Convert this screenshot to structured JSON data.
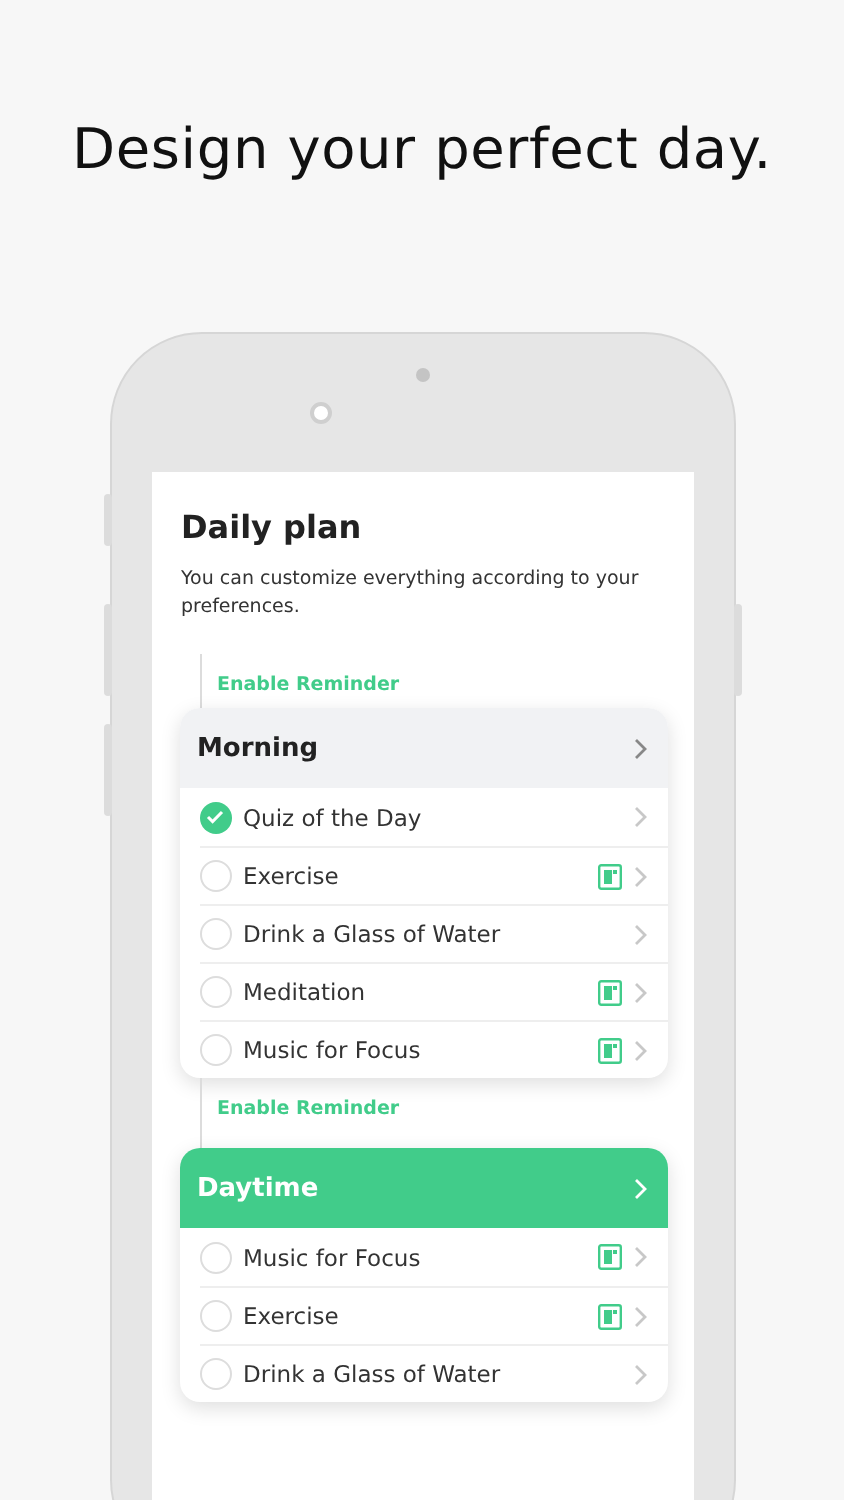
{
  "headline": "Design your perfect day.",
  "screen": {
    "title": "Daily plan",
    "subtitle": "You can customize everything according to your preferences.",
    "sections": [
      {
        "reminder": "Enable Reminder",
        "title": "Morning",
        "highlighted": false,
        "items": [
          {
            "label": "Quiz of the Day",
            "checked": true,
            "note": false
          },
          {
            "label": "Exercise",
            "checked": false,
            "note": true
          },
          {
            "label": "Drink a Glass of Water",
            "checked": false,
            "note": false
          },
          {
            "label": "Meditation",
            "checked": false,
            "note": true
          },
          {
            "label": "Music for Focus",
            "checked": false,
            "note": true
          }
        ]
      },
      {
        "reminder": "Enable Reminder",
        "title": "Daytime",
        "highlighted": true,
        "items": [
          {
            "label": "Music for Focus",
            "checked": false,
            "note": true
          },
          {
            "label": "Exercise",
            "checked": false,
            "note": true
          },
          {
            "label": "Drink a Glass of Water",
            "checked": false,
            "note": false
          }
        ]
      }
    ]
  }
}
